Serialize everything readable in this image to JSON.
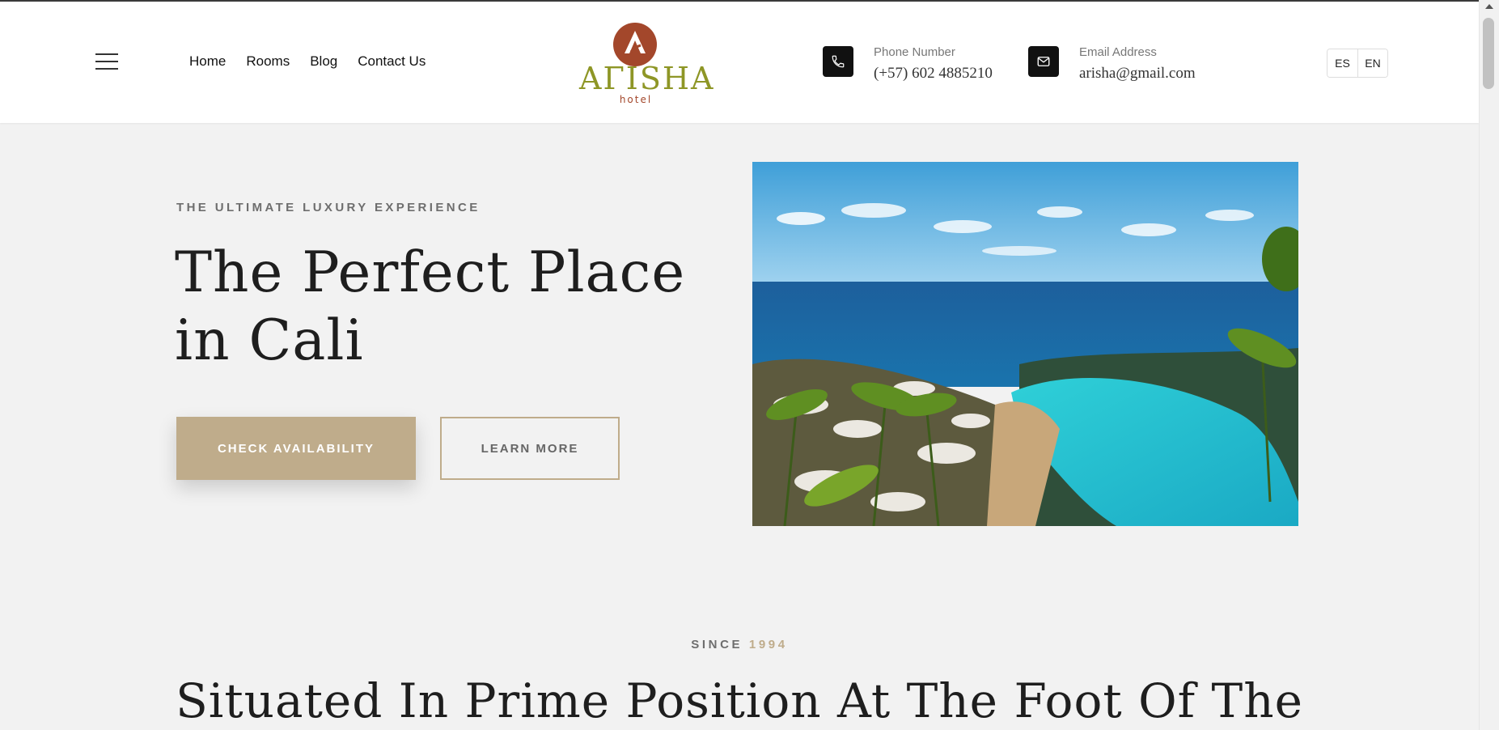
{
  "nav": {
    "menu_icon": "hamburger-menu-icon",
    "items": [
      {
        "label": "Home"
      },
      {
        "label": "Rooms"
      },
      {
        "label": "Blog"
      },
      {
        "label": "Contact Us"
      }
    ]
  },
  "logo": {
    "name": "Arisha",
    "sub": "hotel",
    "colors": {
      "circle": "#a3472b",
      "wordmark": "#8e9626"
    }
  },
  "contact": {
    "phone": {
      "label": "Phone Number",
      "value": "(+57) 602 4885210",
      "icon": "phone-icon"
    },
    "email": {
      "label": "Email Address",
      "value": "arisha@gmail.com",
      "icon": "envelope-icon"
    }
  },
  "language": {
    "options": [
      "ES",
      "EN"
    ]
  },
  "hero": {
    "eyebrow": "THE ULTIMATE LUXURY EXPERIENCE",
    "title": "The Perfect Place in Cali",
    "primary_button": "CHECK AVAILABILITY",
    "secondary_button": "LEARN MORE",
    "image": "resort-infinity-pool-ocean-photo"
  },
  "about": {
    "since_label": "SINCE",
    "since_year": "1994",
    "title": "Situated In Prime Position At The Foot Of The"
  },
  "colors": {
    "accent": "#bfac8b",
    "background": "#f2f2f2",
    "header": "#ffffff",
    "text": "#1e1e1e"
  }
}
